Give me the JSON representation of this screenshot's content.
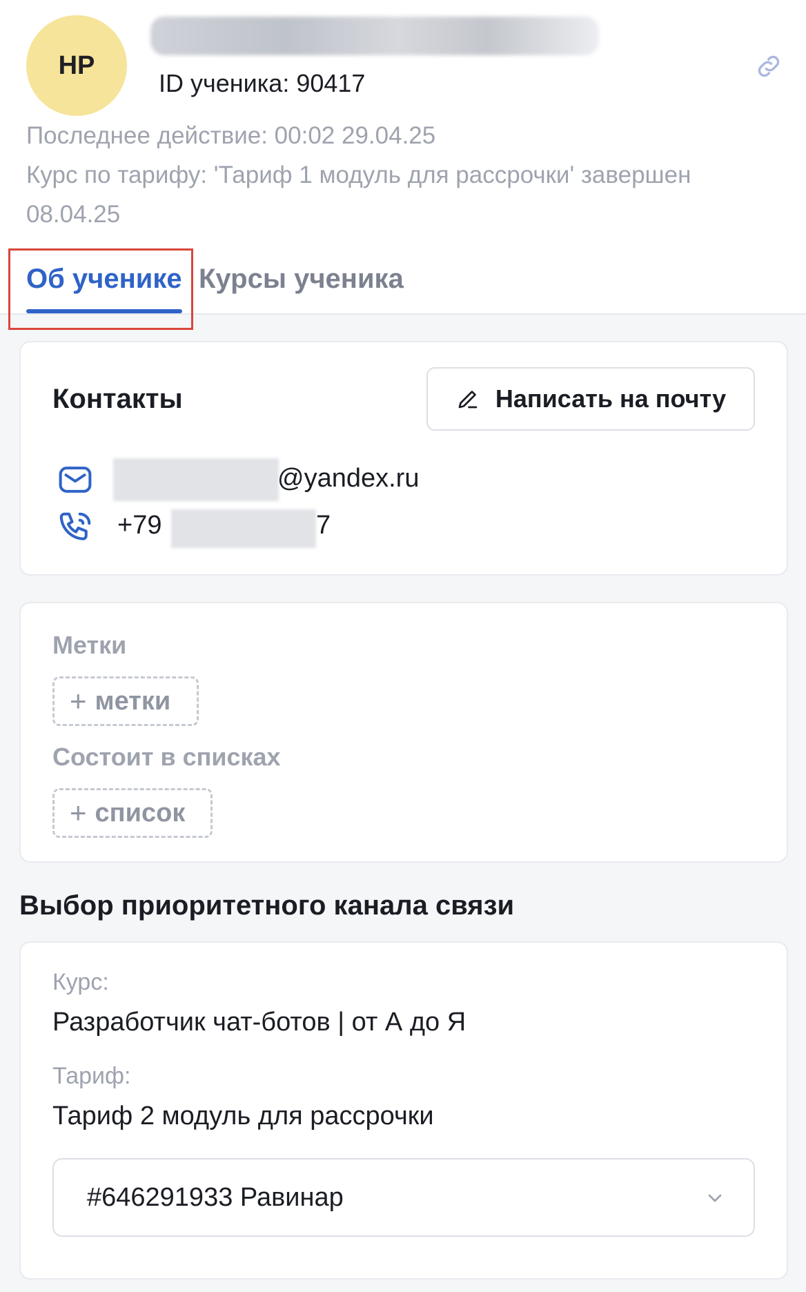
{
  "header": {
    "avatar_initials": "НР",
    "student_id": "ID ученика: 90417",
    "last_action": "Последнее действие: 00:02 29.04.25",
    "course_status": "Курс по тарифу: 'Тариф 1 модуль для рассрочки' завершен 08.04.25"
  },
  "tabs": [
    {
      "label": "Об ученике",
      "active": true
    },
    {
      "label": "Курсы ученика",
      "active": false
    }
  ],
  "contacts": {
    "title": "Контакты",
    "write_email_label": "Написать на почту",
    "email_domain": "@yandex.ru",
    "phone_prefix": "+79",
    "phone_suffix": "7"
  },
  "tags": {
    "tags_label": "Метки",
    "add_tag_label": "метки",
    "lists_label": "Состоит в списках",
    "add_list_label": "список"
  },
  "channel": {
    "section_title": "Выбор приоритетного канала связи",
    "course_label": "Курс:",
    "course_value": "Разработчик чат-ботов | от А до Я",
    "tariff_label": "Тариф:",
    "tariff_value": "Тариф 2 модуль для рассрочки",
    "selected_channel": "#646291933 Равинар"
  },
  "colors": {
    "accent": "#2f63c7",
    "avatar_bg": "#f6e49a",
    "highlight": "#d9463b",
    "muted": "#9ea3ae"
  },
  "icons": [
    "link-icon",
    "pencil-icon",
    "mail-icon",
    "phone-icon",
    "plus-icon",
    "chevron-down-icon"
  ]
}
